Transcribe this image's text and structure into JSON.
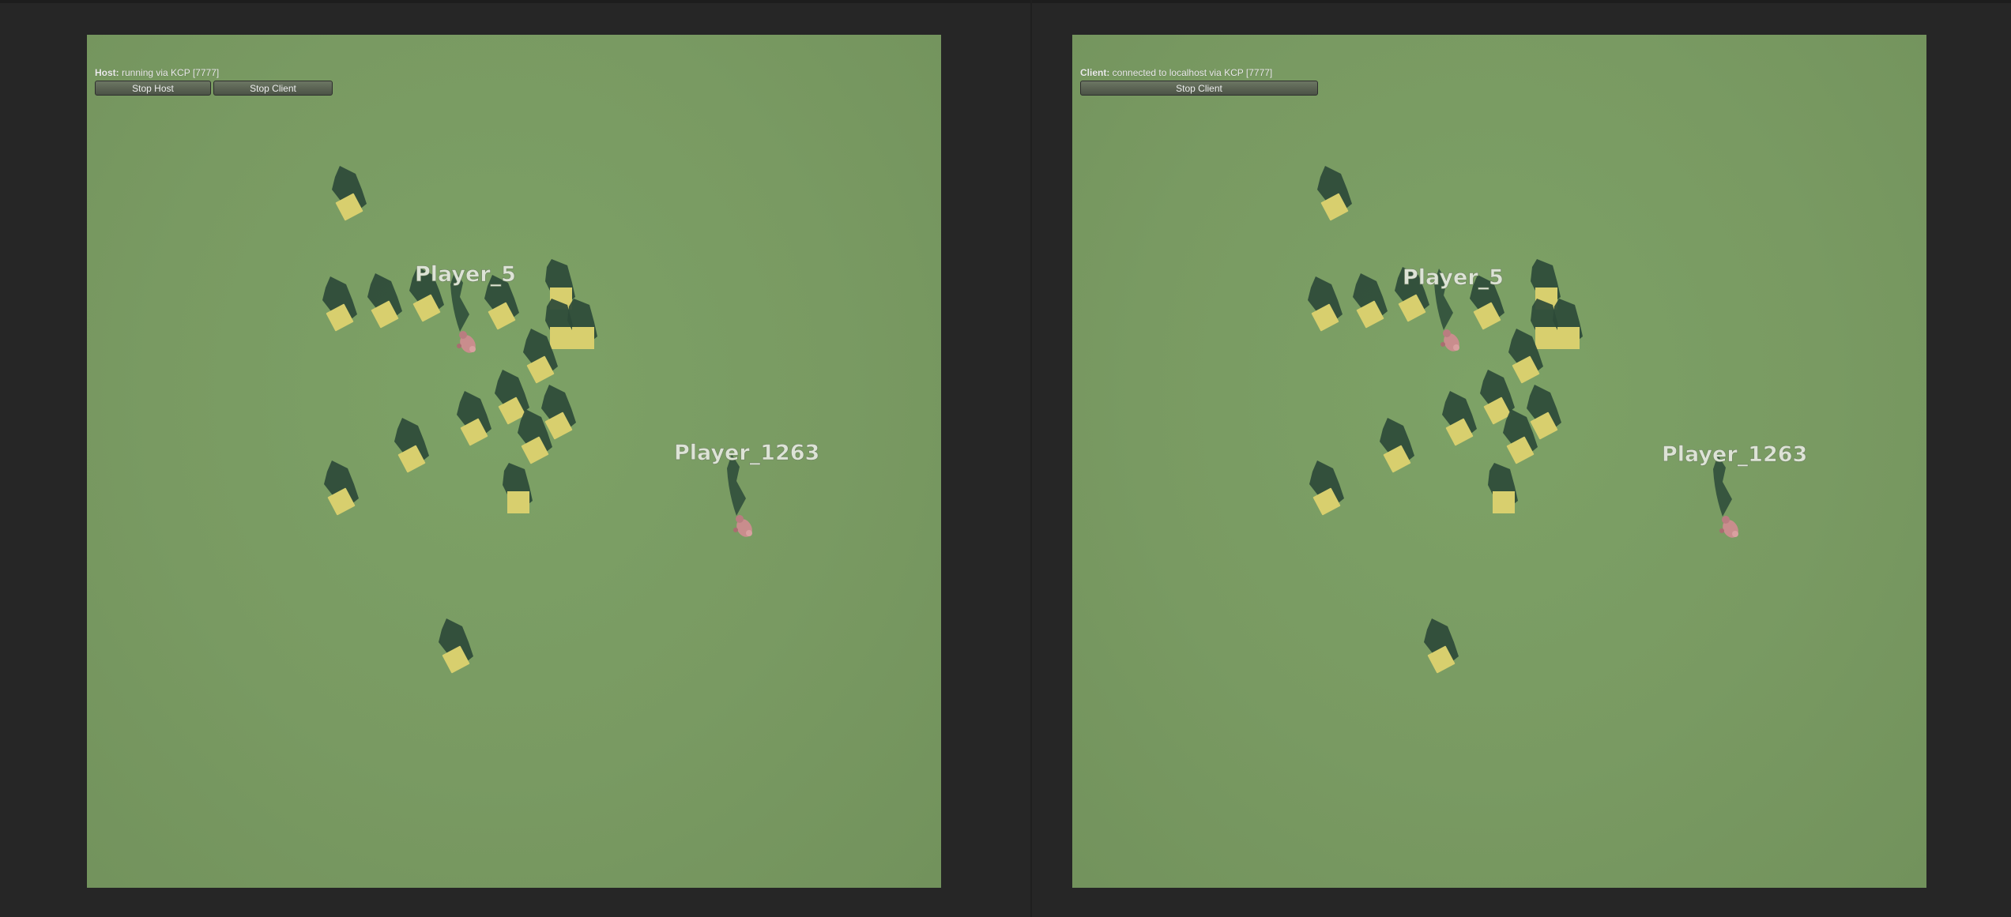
{
  "views": {
    "host": {
      "status_label": "Host:",
      "status_text": " running via KCP [7777]",
      "buttons": {
        "stop_host": "Stop Host",
        "stop_client": "Stop Client"
      }
    },
    "client": {
      "status_label": "Client:",
      "status_text": " connected to localhost via KCP [7777]",
      "buttons": {
        "stop_client": "Stop Client"
      }
    }
  },
  "players": {
    "p1": {
      "name": "Player_5"
    },
    "p2": {
      "name": "Player_1263"
    }
  },
  "colors": {
    "ground": "#799a62",
    "cube": "#d8cf6e",
    "shadow": "#2c4a38",
    "avatar": "#c98d8d",
    "background": "#262626"
  }
}
